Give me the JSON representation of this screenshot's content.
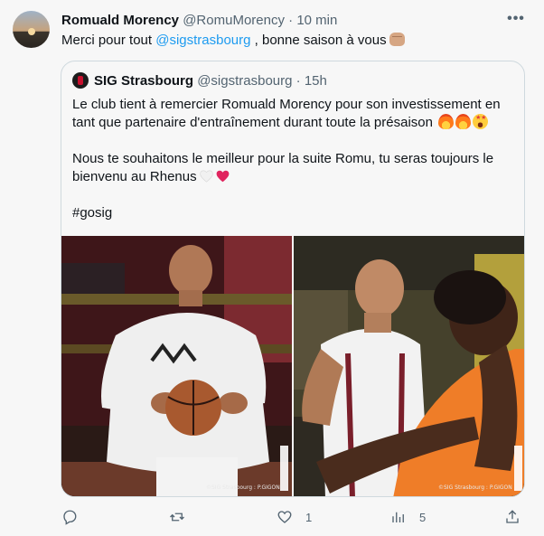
{
  "tweet": {
    "author_name": "Romuald Morency",
    "author_handle": "@RomuMorency",
    "separator": "·",
    "time": "10 min",
    "text_before": "Merci pour tout ",
    "mention": "@sigstrasbourg",
    "text_after": " , bonne saison à vous",
    "icons": {
      "avatar": "profile-photo",
      "more": "more-options-icon",
      "emoji": "fist-bump-emoji"
    }
  },
  "quoted": {
    "author_name": "SIG Strasbourg",
    "author_handle": "@sigstrasbourg",
    "separator": "·",
    "time": "15h",
    "line1": "Le club tient à remercier Romuald Morency pour son investissement en",
    "line2": "tant que partenaire d'entraînement durant toute la présaison",
    "line3": "Nous te souhaitons le meilleur pour la suite Romu, tu seras toujours le",
    "line4": "bienvenu au Rhenus",
    "hashtag": "#gosig",
    "media": {
      "left_credit": "©SIG Strasbourg : P.GIGON",
      "right_credit": "©SIG Strasbourg : P.GIGON"
    }
  },
  "actions": {
    "reply": {
      "icon": "reply-icon",
      "count": ""
    },
    "retweet": {
      "icon": "retweet-icon",
      "count": ""
    },
    "like": {
      "icon": "like-icon",
      "count": "1"
    },
    "views": {
      "icon": "views-icon",
      "count": "5"
    },
    "share": {
      "icon": "share-icon",
      "count": ""
    }
  },
  "colors": {
    "accent": "#1d9bf0",
    "muted": "#536471",
    "text": "#0f1419",
    "border": "#cfd9de"
  }
}
